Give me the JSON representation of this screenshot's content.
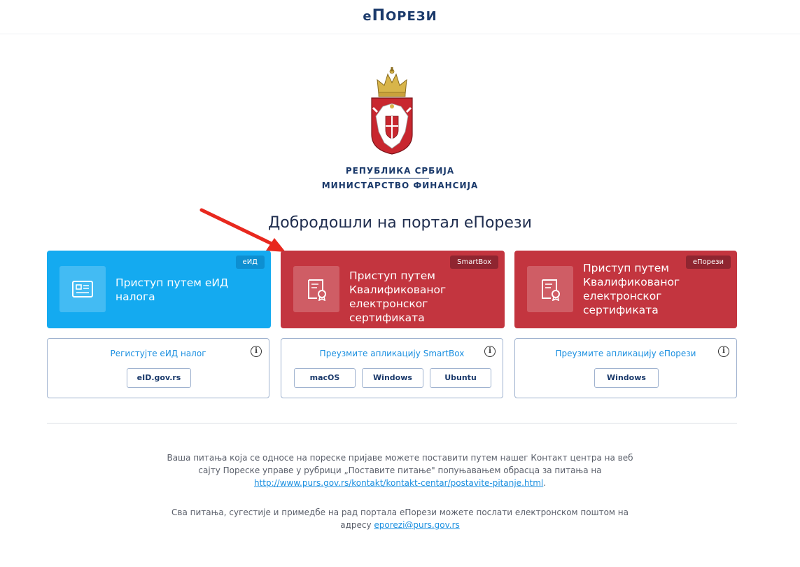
{
  "header": {
    "brand_e": "е",
    "brand_p": "П",
    "brand_rest": "ОРЕЗИ"
  },
  "org": {
    "line1": "Република Србија",
    "line2": "Министарство финансија"
  },
  "welcome": "Добродошли на портал еПорези",
  "cards": [
    {
      "title": "Приступ путем еИД налога",
      "badge": "еИД",
      "icon": "id-card-icon"
    },
    {
      "title": "Приступ путем Квалификованог електронског сертификата",
      "badge": "SmartBox",
      "icon": "certificate-icon"
    },
    {
      "title": "Приступ путем Квалификованог електронског сертификата",
      "badge": "еПорези",
      "icon": "certificate-icon"
    }
  ],
  "panels": [
    {
      "link": "Регистујте еИД налог",
      "info": "i",
      "buttons": [
        "eID.gov.rs"
      ]
    },
    {
      "link": "Преузмите апликацију SmartBox",
      "info": "i",
      "buttons": [
        "macOS",
        "Windows",
        "Ubuntu"
      ]
    },
    {
      "link": "Преузмите апликацију еПорези",
      "info": "i",
      "buttons": [
        "Windows"
      ]
    }
  ],
  "footer": {
    "p1_line1": "Ваша питања која се односе на пореске пријаве можете поставити путем нашег Контакт центра на веб",
    "p1_line2": "сајту Пореске управе у рубрици „Поставите питање\" попуњавањем обрасца за питања на",
    "p1_link": "http://www.purs.gov.rs/kontakt/kontakt-centar/postavite-pitanje.html",
    "p1_end": ".",
    "p2_line1": "Сва питања, сугестије и примедбе на рад портала еПорези можете послати електронском поштом на",
    "p2_prefix": "адресу ",
    "p2_email": "eporezi@purs.gov.rs"
  },
  "colors": {
    "blue": "#14aaf0",
    "red": "#c3353f",
    "navy": "#1b3a6b",
    "link": "#1a8fe0",
    "arrow": "#e8281e"
  }
}
